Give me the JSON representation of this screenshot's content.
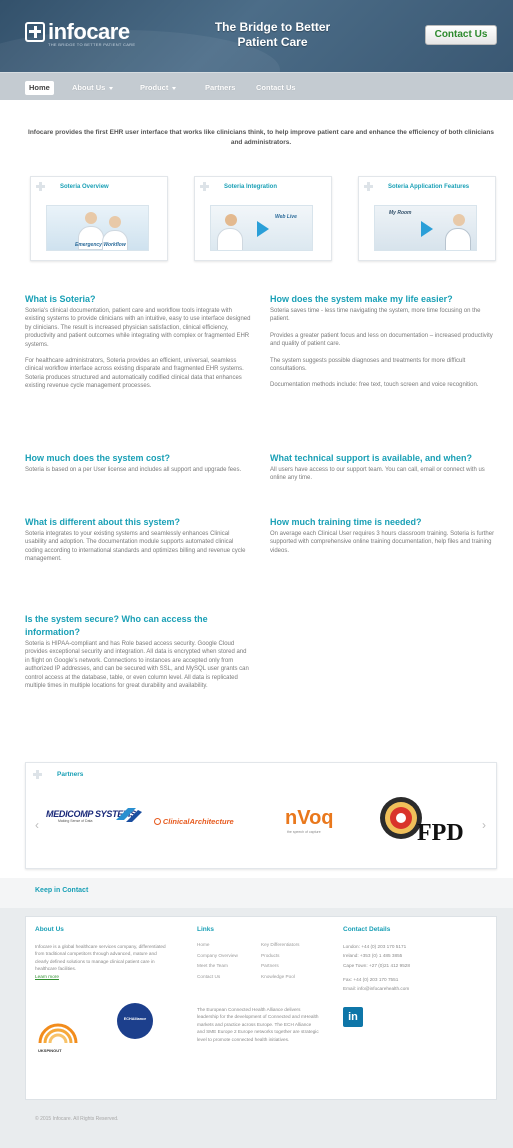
{
  "header": {
    "logo_text": "infocare",
    "logo_tagline": "THE BRIDGE TO BETTER PATIENT CARE",
    "tagline_line1": "The Bridge to Better",
    "tagline_line2": "Patient Care",
    "contact_button": "Contact Us"
  },
  "nav": {
    "items": [
      {
        "label": "Home",
        "active": true
      },
      {
        "label": "About Us",
        "dropdown": true
      },
      {
        "label": "Product",
        "dropdown": true
      },
      {
        "label": "Partners"
      },
      {
        "label": "Contact Us"
      }
    ]
  },
  "intro": "Infocare provides the first EHR user interface that works like clinicians think, to help improve patient care and enhance the efficiency of both clinicians and administrators.",
  "cards": [
    {
      "title": "Soteria Overview",
      "overlay": "Emergency Workflow"
    },
    {
      "title": "Soteria Integration",
      "overlay": "Web Live"
    },
    {
      "title": "Soteria Application Features",
      "overlay": "My Room"
    }
  ],
  "qa_left": [
    {
      "question": "What is Soteria?",
      "paragraphs": [
        "Soteria's clinical documentation, patient care and workflow tools integrate with existing systems to provide clinicians with an intuitive, easy to use interface designed by clinicians. The result is increased physician satisfaction, clinical efficiency, productivity and patient outcomes while integrating with complex or fragmented EHR systems.",
        "For healthcare administrators, Soteria provides an efficient, universal, seamless clinical workflow interface across existing disparate and fragmented EHR systems. Soteria produces structured and automatically codified clinical data that enhances existing revenue cycle management processes."
      ]
    },
    {
      "question": "How much does the system cost?",
      "paragraphs": [
        "Soteria is based on a per User license and includes all support and upgrade fees."
      ]
    },
    {
      "question": "What is different about this system?",
      "paragraphs": [
        "Soteria integrates to your existing systems and seamlessly enhances Clinical usability and adoption. The documentation module supports automated clinical coding according to international standards and optimizes billing and revenue cycle management."
      ]
    },
    {
      "question": "Is the system secure? Who can access the information?",
      "paragraphs": [
        "Soteria is HIPAA-compliant and has Role based access security. Google Cloud provides exceptional security and integration. All data is encrypted when stored and in flight on Google's network. Connections to instances are accepted only from authorized IP addresses, and can be secured with SSL, and MySQL user grants can control access at the database, table, or even column level. All data is replicated multiple times in multiple locations for great durability and availability."
      ]
    }
  ],
  "qa_right": [
    {
      "question": "How does the system make my life easier?",
      "paragraphs": [
        "Soteria saves time - less time navigating the system, more time focusing on the patient.",
        "Provides a greater patient focus and less on documentation – increased productivity and quality of patient care.",
        "The system suggests possible diagnoses and treatments for more difficult consultations.",
        "Documentation methods include: free text, touch screen and voice recognition."
      ]
    },
    {
      "question": "What technical support is available, and when?",
      "paragraphs": [
        "All users have access to our support team. You can call, email or connect with us online any time."
      ]
    },
    {
      "question": "How much training time is needed?",
      "paragraphs": [
        "On average each Clinical User requires 3 hours classroom training. Soteria is further supported with comprehensive online training documentation, help files and training videos."
      ]
    }
  ],
  "partners": {
    "title": "Partners",
    "logos": [
      "MEDICOMP SYSTEMS",
      "ClinicalArchitecture",
      "nVoq",
      "FPD"
    ],
    "medicomp_sub": "Making Sense of Data",
    "nvoq_sub": "the speech of capture",
    "prev": "‹",
    "next": "›"
  },
  "keep_in_contact": "Keep in Contact",
  "footer": {
    "about": {
      "title": "About Us",
      "text": "Infocare is a global healthcare services company, differentiated from traditional competitors through advanced, mature and clearly defined solutions to manage clinical patient care in healthcare facilities.",
      "learn_more": "Learn more"
    },
    "links": {
      "title": "Links",
      "col1": [
        "Home",
        "Company Overview",
        "Meet the Team",
        "Contact Us"
      ],
      "col2": [
        "Key Differentiators",
        "Products",
        "Partners",
        "Knowledge Pool"
      ],
      "echa_text": "The European Connected Health Alliance delivers leadership for the development of Connected and mHealth markets and practice across Europe. The ECH Alliance and SME Europe 2 Europe networks together are strategic level to promote connected health initiatives."
    },
    "contact": {
      "title": "Contact Details",
      "lines": [
        "London: +44 (0) 203 170 5171",
        "Ireland: +353 (0) 1 485 3855",
        "Cape Town: +27 (0)21 412 9528",
        "",
        "Fax: +44 (0) 203 170 7551",
        "Email: info@infocarehealth.com"
      ],
      "linkedin": "in"
    },
    "badges": [
      "UKSPINOUT",
      "ECHAlliance"
    ]
  },
  "copyright": "© 2015 Infocare. All Rights Reserved.",
  "colors": {
    "accent": "#1aa0b6",
    "header": "#3f5f7a",
    "green": "#2d8a2d"
  }
}
